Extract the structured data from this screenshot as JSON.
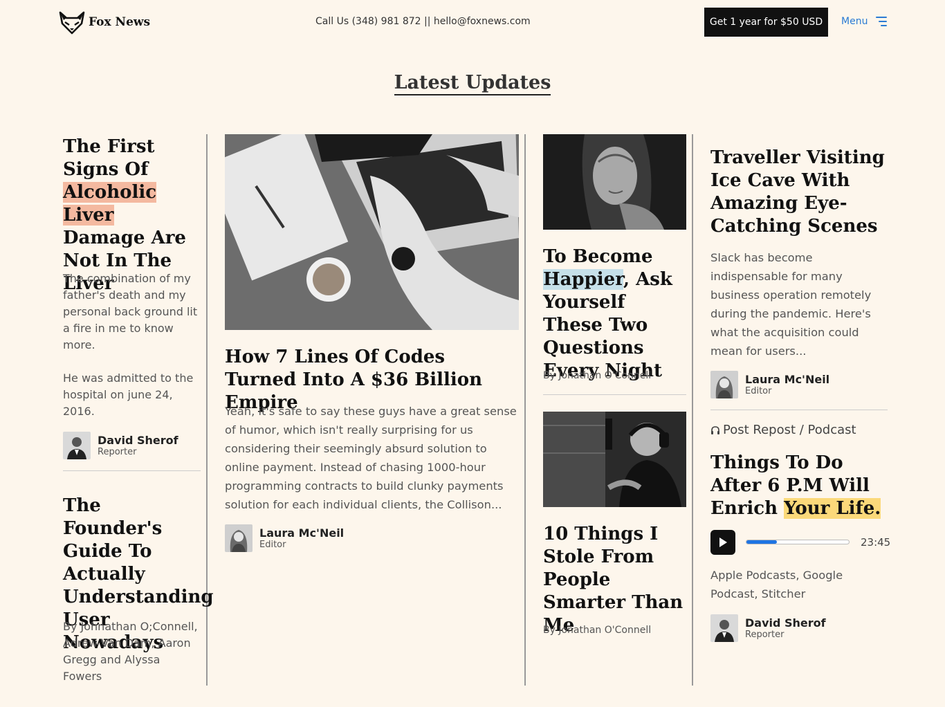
{
  "header": {
    "brand": "Fox News",
    "contact": "Call Us (348) 981 872 || hello@foxnews.com",
    "cta_label": "Get 1 year for $50 USD",
    "menu_label": "Menu"
  },
  "section": {
    "title": "Latest Updates"
  },
  "col1": {
    "article1": {
      "title_pre": "The First Signs Of ",
      "title_hl": "Alcoholic Liver",
      "title_post": " Damage Are Not In The Liver",
      "para1": "The combination of my father's death and my personal back ground lit a fire in me to know more.",
      "para2": "He was admitted to the hospital on june 24, 2016.",
      "author_name": "David Sherof",
      "author_role": "Reporter"
    },
    "article2": {
      "title": "The Founder's Guide To Actually Understanding User Nowadays",
      "byline": "By Johnathan O;Connell, Adrew Van Dam, Aaron Gregg and Alyssa Fowers"
    }
  },
  "col2": {
    "title": "How 7 Lines Of Codes Turned Into A $36 Billion Empire",
    "excerpt": "Yeah, it's safe to say these guys have a great sense of humor, which isn't really surprising for us considering their seemingly absurd solution to online payment. Instead of chasing 1000-hour programming contracts to build clunky payments solution for each individual clients, the Collison...",
    "author_name": "Laura Mc'Neil",
    "author_role": "Editor"
  },
  "col3": {
    "article1": {
      "title_pre": "To Become ",
      "title_hl": "Happier",
      "title_post": ", Ask Yourself These Two Questions Every Night",
      "byline": "By Jonathan O'Connell"
    },
    "article2": {
      "title": "10 Things I Stole From People Smarter Than Me",
      "byline": "By Jonathan O'Connell"
    }
  },
  "col4": {
    "article1": {
      "title": "Traveller Visiting Ice Cave With Amazing Eye-Catching Scenes",
      "excerpt": "Slack has become indispensable for many business operation remotely during the pandemic. Here's what the acquisition could mean for users...",
      "author_name": "Laura Mc'Neil",
      "author_role": "Editor"
    },
    "podcast": {
      "category": "Post Repost / Podcast",
      "title_pre": "Things To Do After 6 P.M Will Enrich ",
      "title_hl": "Your Life.",
      "duration": "23:45",
      "progress": 0.3,
      "platforms": "Apple Podcasts, Google Podcast, Stitcher",
      "author_name": "David Sherof",
      "author_role": "Reporter"
    }
  },
  "colors": {
    "background": "#fdf6ec",
    "highlight_orange": "#f4b9a0",
    "highlight_blue": "#c6e0e9",
    "highlight_yellow": "#fbd97a",
    "link_blue": "#2a7bd4",
    "progress_blue": "#1e74e3"
  },
  "icons": [
    "fox-logo-icon",
    "hamburger-menu-icon",
    "headphones-icon",
    "play-icon"
  ]
}
